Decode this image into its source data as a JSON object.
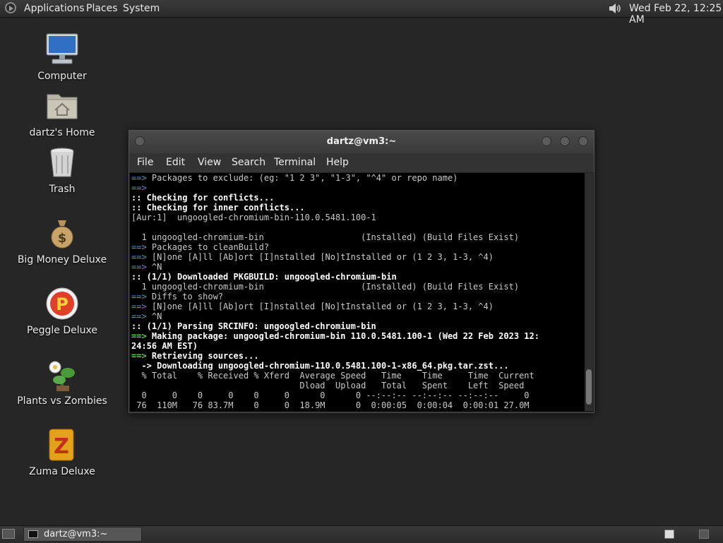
{
  "top_panel": {
    "menus": [
      "Applications",
      "Places",
      "System"
    ],
    "clock": "Wed Feb 22, 12:25 AM"
  },
  "desktop_icons": [
    {
      "label": "Computer",
      "icon": "computer-icon"
    },
    {
      "label": "dartz's Home",
      "icon": "home-folder-icon"
    },
    {
      "label": "Trash",
      "icon": "trash-icon"
    },
    {
      "label": "Big Money Deluxe",
      "icon": "money-bag-icon"
    },
    {
      "label": "Peggle Deluxe",
      "icon": "peggle-icon"
    },
    {
      "label": "Plants vs Zombies",
      "icon": "plant-icon"
    },
    {
      "label": "Zuma Deluxe",
      "icon": "zuma-icon"
    }
  ],
  "terminal": {
    "title": "dartz@vm3:~",
    "menus": [
      "File",
      "Edit",
      "View",
      "Search",
      "Terminal",
      "Help"
    ],
    "lines": [
      {
        "text": "==> Packages to exclude: (eg: \"1 2 3\", \"1-3\", \"^4\" or repo name)",
        "style": "normal",
        "prefix": "==>"
      },
      {
        "text": "==>",
        "style": "normal",
        "prefix": "==>"
      },
      {
        "text": ":: Checking for conflicts...",
        "style": "bold"
      },
      {
        "text": ":: Checking for inner conflicts...",
        "style": "bold"
      },
      {
        "text": "[Aur:1]  ungoogled-chromium-bin-110.0.5481.100-1",
        "style": "normal"
      },
      {
        "text": "",
        "style": "normal"
      },
      {
        "text": "  1 ungoogled-chromium-bin                   (Installed) (Build Files Exist)",
        "style": "normal"
      },
      {
        "text": "==> Packages to cleanBuild?",
        "style": "normal",
        "prefix": "==>"
      },
      {
        "text": "==> [N]one [A]ll [Ab]ort [I]nstalled [No]tInstalled or (1 2 3, 1-3, ^4)",
        "style": "normal",
        "prefix": "==>"
      },
      {
        "text": "==> ^N",
        "style": "normal",
        "prefix": "==>"
      },
      {
        "text": ":: (1/1) Downloaded PKGBUILD: ungoogled-chromium-bin",
        "style": "bold"
      },
      {
        "text": "  1 ungoogled-chromium-bin                   (Installed) (Build Files Exist)",
        "style": "normal"
      },
      {
        "text": "==> Diffs to show?",
        "style": "normal",
        "prefix": "==>"
      },
      {
        "text": "==> [N]one [A]ll [Ab]ort [I]nstalled [No]tInstalled or (1 2 3, 1-3, ^4)",
        "style": "normal",
        "prefix": "==>"
      },
      {
        "text": "==> ^N",
        "style": "normal",
        "prefix": "==>"
      },
      {
        "text": ":: (1/1) Parsing SRCINFO: ungoogled-chromium-bin",
        "style": "bold"
      },
      {
        "text": "==> Making package: ungoogled-chromium-bin 110.0.5481.100-1 (Wed 22 Feb 2023 12:",
        "style": "make",
        "prefix": "==>"
      },
      {
        "text": "24:56 AM EST)",
        "style": "make"
      },
      {
        "text": "==> Retrieving sources...",
        "style": "make",
        "prefix": "==>"
      },
      {
        "text": "  -> Downloading ungoogled-chromium-110.0.5481.100-1-x86_64.pkg.tar.zst...",
        "style": "make",
        "prefix": "->"
      },
      {
        "text": "  % Total    % Received % Xferd  Average Speed   Time    Time     Time  Current",
        "style": "normal"
      },
      {
        "text": "                                 Dload  Upload   Total   Spent    Left  Speed",
        "style": "normal"
      },
      {
        "text": "  0     0    0     0    0     0      0      0 --:--:-- --:--:-- --:--:--     0",
        "style": "normal"
      },
      {
        "text": " 76  110M   76 83.7M    0     0  18.9M      0  0:00:05  0:00:04  0:00:01 27.0M",
        "style": "normal"
      }
    ]
  },
  "taskbar": {
    "window_label": "dartz@vm3:~"
  }
}
